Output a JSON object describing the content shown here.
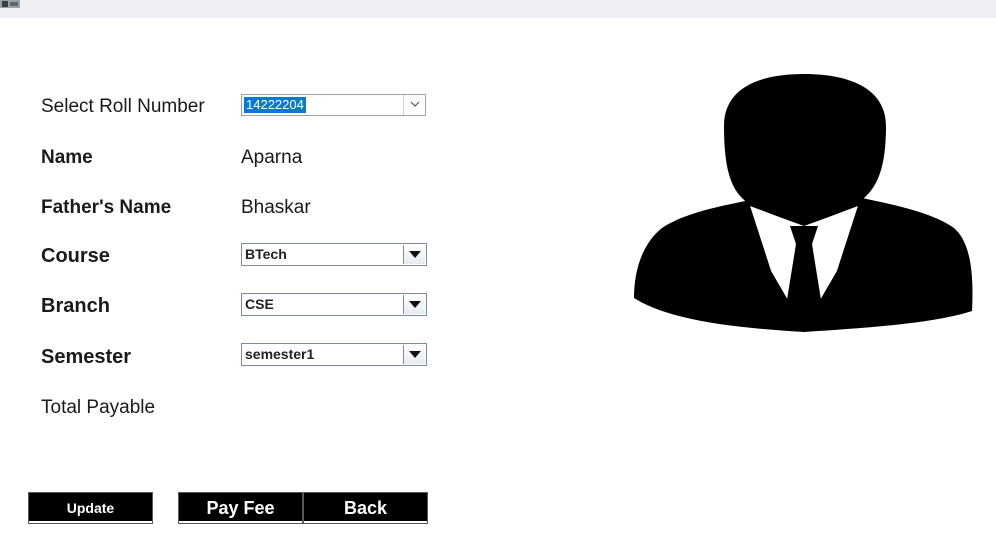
{
  "window": {
    "icon": "app-icon"
  },
  "form": {
    "roll_label": "Select Roll Number",
    "roll_value": "14222204",
    "name_label": "Name",
    "name_value": "Aparna",
    "father_label": "Father's Name",
    "father_value": "Bhaskar",
    "course_label": "Course",
    "course_value": "BTech",
    "branch_label": "Branch",
    "branch_value": "CSE",
    "semester_label": "Semester",
    "semester_value": "semester1",
    "total_label": "Total Payable"
  },
  "buttons": {
    "update": "Update",
    "payfee": "Pay Fee",
    "back": "Back"
  },
  "colors": {
    "selection": "#0a78d7",
    "button_bg": "#000000",
    "button_text": "#ffffff"
  },
  "icons": {
    "avatar": "user-silhouette-icon",
    "dropdown": "chevron-down-icon"
  }
}
